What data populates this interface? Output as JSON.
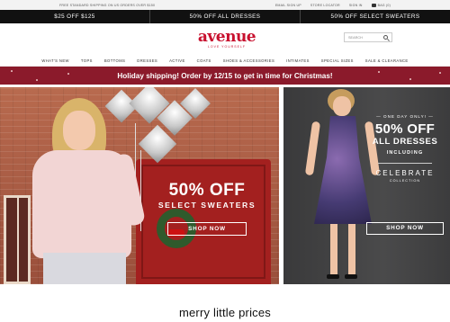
{
  "utility": {
    "shipping_note": "Free standard shipping on US orders over $150",
    "email_signup": "Email sign up",
    "store_locator": "Store locator",
    "sign_in": "Sign in",
    "bag": "Bag (0)"
  },
  "promo": [
    "$25 OFF $125",
    "50% OFF ALL DRESSES",
    "50% OFF SELECT SWEATERS"
  ],
  "header": {
    "logo_text": "avenue",
    "tagline": "Love yourself",
    "search_placeholder": "Search"
  },
  "nav": [
    "What's New",
    "Tops",
    "Bottoms",
    "Dresses",
    "Active",
    "Coats",
    "Shoes & Accessories",
    "Intimates",
    "Special Sizes",
    "Sale & Clearance"
  ],
  "holiday_banner": "Holiday shipping! Order by 12/15 to get in time for Christmas!",
  "hero_left": {
    "headline": "50% OFF",
    "subhead": "SELECT SWEATERS",
    "cta": "Shop Now"
  },
  "hero_right": {
    "kicker": "One day only!",
    "headline": "50% OFF",
    "subhead": "ALL DRESSES",
    "including": "INCLUDING",
    "collection_name": "CELEBRATE",
    "collection_label": "Collection",
    "cta": "Shop Now"
  },
  "section_headline": "merry little prices",
  "colors": {
    "brand_red": "#c8102e",
    "holiday_banner": "#8b1a2b",
    "promo_bar": "#111111"
  }
}
